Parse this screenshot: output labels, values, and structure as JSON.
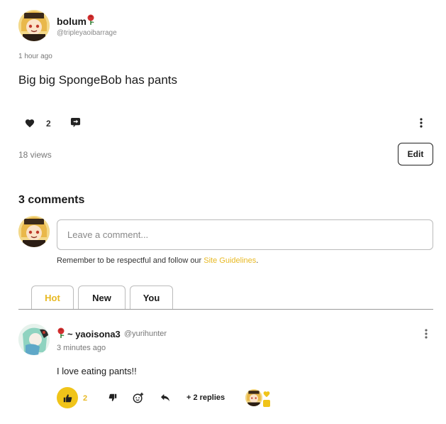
{
  "post": {
    "username": "bolum",
    "handle": "@tripleyaoibarrage",
    "timestamp": "1 hour ago",
    "text": "Big big SpongeBob has pants",
    "like_count": "2",
    "views": "18 views",
    "edit_label": "Edit"
  },
  "comments_section": {
    "title": "3 comments",
    "input_placeholder": "Leave a comment...",
    "guidelines_prefix": "Remember to be respectful and follow our ",
    "guidelines_link": "Site Guidelines",
    "guidelines_suffix": ".",
    "tabs": [
      {
        "label": "Hot",
        "active": true
      },
      {
        "label": "New",
        "active": false
      },
      {
        "label": "You",
        "active": false
      }
    ]
  },
  "comment": {
    "name": "~ yaoisona3",
    "handle": "@yurihunter",
    "timestamp": "3 minutes ago",
    "text": "I love eating pants!!",
    "like_count": "2",
    "replies_label": "+ 2 replies"
  },
  "colors": {
    "accent": "#e8b923",
    "like_button": "#f0c419",
    "rose": "#d32f2f"
  },
  "icons": [
    "rose-icon",
    "heart-icon",
    "share-icon",
    "more-vertical-icon",
    "thumbs-up-icon",
    "thumbs-down-icon",
    "add-reaction-icon",
    "reply-icon"
  ]
}
